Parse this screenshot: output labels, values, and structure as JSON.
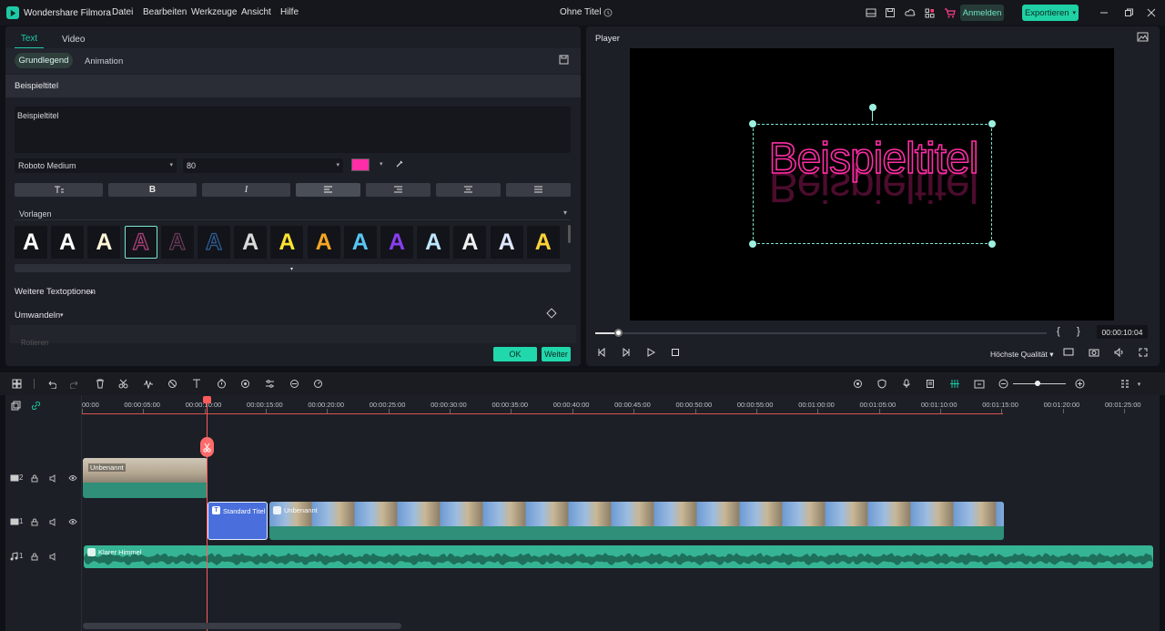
{
  "app": {
    "name": "Wondershare Filmora",
    "doc_title": "Ohne Titel"
  },
  "menu": [
    "Datei",
    "Bearbeiten",
    "Werkzeuge",
    "Ansicht",
    "Hilfe"
  ],
  "header_buttons": {
    "login": "Anmelden",
    "export": "Exportieren"
  },
  "left_panel": {
    "tabs": [
      "Text",
      "Video"
    ],
    "subtabs": [
      "Grundlegend",
      "Animation"
    ],
    "section_title": "Beispieltitel",
    "text_value": "Beispieltitel",
    "font": "Roboto Medium",
    "size": "80",
    "text_color": "#ff2da6",
    "format_buttons": [
      "B",
      "I"
    ],
    "presets_label": "Vorlagen",
    "presets": [
      {
        "glyph": "A",
        "color": "#ffffff"
      },
      {
        "glyph": "A",
        "color": "#ffffff"
      },
      {
        "glyph": "A",
        "color": "#fff5d6"
      },
      {
        "glyph": "A",
        "color": "#b4437f"
      },
      {
        "glyph": "A",
        "color": "#5b3348"
      },
      {
        "glyph": "A",
        "color": "#1d3b5e"
      },
      {
        "glyph": "A",
        "color": "#d9d9d9"
      },
      {
        "glyph": "A",
        "color": "#ffe234"
      },
      {
        "glyph": "A",
        "color": "#f5a623"
      },
      {
        "glyph": "A",
        "color": "#58c6f5"
      },
      {
        "glyph": "A",
        "color": "#8a3df0"
      },
      {
        "glyph": "A",
        "color": "#bfe6ff"
      },
      {
        "glyph": "A",
        "color": "#f0f0f0"
      },
      {
        "glyph": "A",
        "color": "#e0e8ff"
      },
      {
        "glyph": "A",
        "color": "#ffd23a"
      }
    ],
    "more_options": "Weitere Textoptionen",
    "transform": "Umwandeln",
    "rotation": "Rotieren",
    "ok": "OK",
    "next": "Weiter"
  },
  "player": {
    "label": "Player",
    "title_text": "Beispieltitel",
    "timecode": "00:00:10:04",
    "quality": "Höchste Qualität",
    "progress": 0.05
  },
  "timeline": {
    "ticks": [
      "00:00",
      "00:00:05:00",
      "00:00:10:00",
      "00:00:15:00",
      "00:00:20:00",
      "00:00:25:00",
      "00:00:30:00",
      "00:00:35:00",
      "00:00:40:00",
      "00:00:45:00",
      "00:00:50:00",
      "00:00:55:00",
      "00:01:00:00",
      "00:01:05:00",
      "00:01:10:00",
      "00:01:15:00",
      "00:01:20:00",
      "00:01:25:00"
    ],
    "tracks": [
      "2",
      "1",
      "1"
    ],
    "clips": {
      "v2": "Unbenannt",
      "title": "Standard Titel",
      "v1": "Unbenannt",
      "audio": "Klarer Himmel"
    }
  }
}
